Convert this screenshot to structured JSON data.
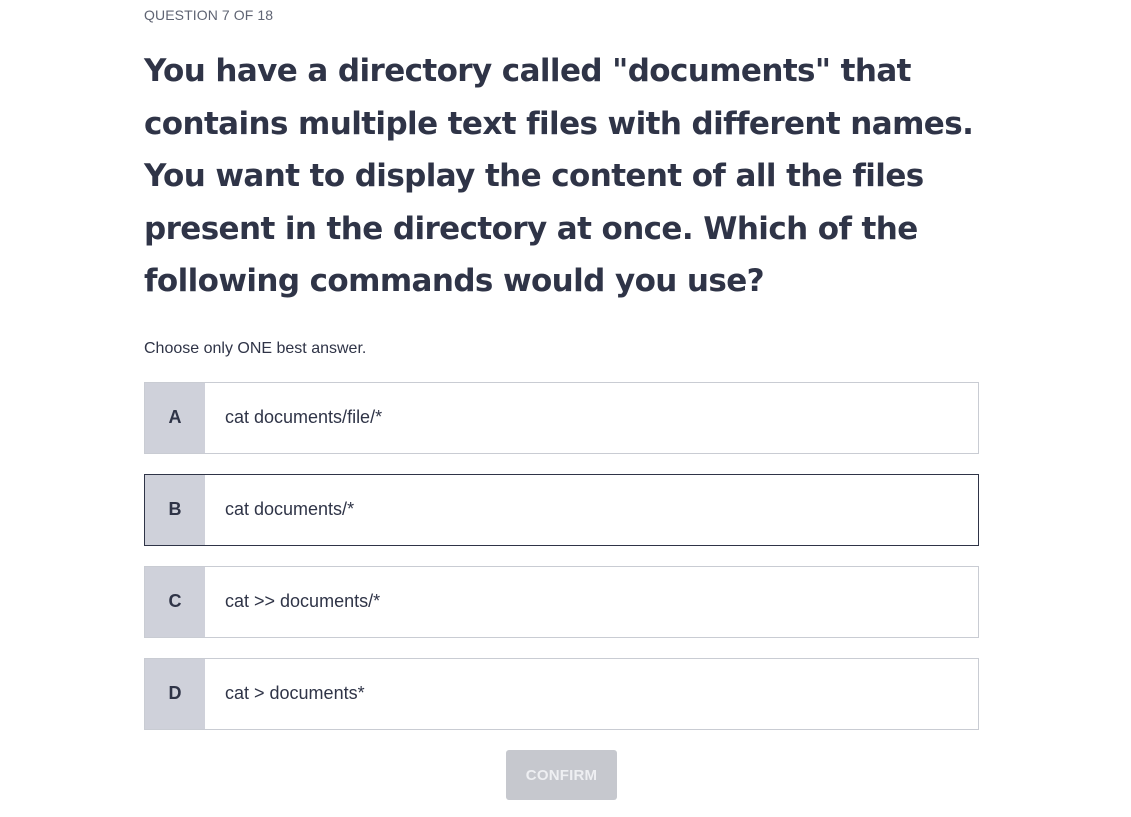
{
  "header": {
    "counter": "QUESTION 7 OF 18"
  },
  "question": {
    "text": "You have a directory called \"documents\" that contains multiple text files with different names. You want to display the content of all the files present in the directory at once. Which of the following commands would you use?",
    "instruction": "Choose only ONE best answer."
  },
  "options": [
    {
      "letter": "A",
      "text": "cat documents/file/*"
    },
    {
      "letter": "B",
      "text": "cat documents/*"
    },
    {
      "letter": "C",
      "text": "cat >> documents/*"
    },
    {
      "letter": "D",
      "text": "cat > documents*"
    }
  ],
  "selected_option": "B",
  "confirm": {
    "label": "CONFIRM",
    "enabled": false
  },
  "colors": {
    "text": "#2f3447",
    "letter_bg": "#cfd1da",
    "border": "#c9ccd3",
    "selected_border": "#2f3447",
    "button_bg": "#c6c8ce"
  }
}
